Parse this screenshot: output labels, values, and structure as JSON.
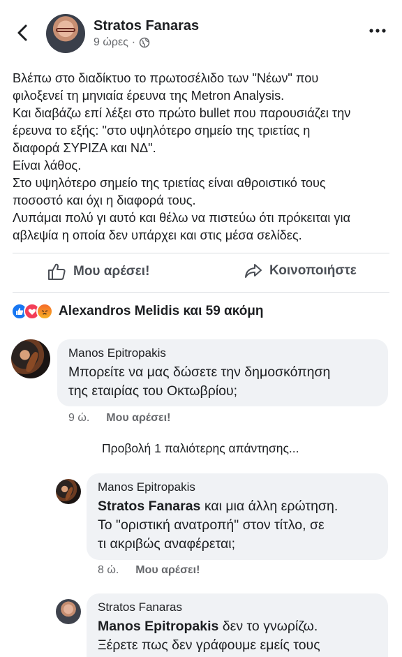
{
  "header": {
    "author": "Stratos Fanaras",
    "time": "9 ώρες",
    "dot": "·"
  },
  "post": {
    "lines": [
      "Βλέπω στο διαδίκτυο το πρωτοσέλιδο των \"Νέων\" που",
      "φιλοξενεί τη μηνιαία έρευνα της Metron Analysis.",
      "Και διαβάζω επί λέξει στο πρώτο bullet που παρουσιάζει την",
      "έρευνα το εξής: \"στο υψηλότερο σημείο της τριετίας η",
      "διαφορά ΣΥΡΙΖΑ και ΝΔ\".",
      "Είναι λάθος.",
      "Στο υψηλότερο σημείο της τριετίας είναι αθροιστικό τους",
      "ποσοστό και όχι η διαφορά τους.",
      "Λυπάμαι πολύ γι αυτό και θέλω να πιστεύω ότι πρόκειται για",
      "αβλεψία η οποία δεν υπάρχει και στις μέσα σελίδες."
    ]
  },
  "actions": {
    "like": "Μου αρέσει!",
    "share": "Κοινοποιήστε"
  },
  "reactions": {
    "text": "Alexandros Melidis και 59 ακόμη"
  },
  "comments": [
    {
      "name": "Manos Epitropakis",
      "lines": [
        "Μπορείτε να μας δώσετε την δημοσκόπηση",
        "της εταιρίας του Οκτωβρίου;"
      ],
      "time": "9 ώ.",
      "like": "Μου αρέσει!"
    }
  ],
  "view_more": "Προβολή 1 παλιότερης απάντησης...",
  "replies": [
    {
      "name": "Manos Epitropakis",
      "mention": "Stratos Fanaras",
      "line1_rest": " και μια άλλη ερώτηση.",
      "lines": [
        "Το \"οριστική ανατροπή\" στον τίτλο, σε",
        "τι ακριβώς αναφέρεται;"
      ],
      "time": "8 ώ.",
      "like": "Μου αρέσει!"
    },
    {
      "name": "Stratos Fanaras",
      "mention": "Manos Epitropakis",
      "line1_rest": " δεν το γνωρίζω.",
      "lines": [
        "Ξέρετε πως δεν γράφουμε εμείς τους"
      ]
    }
  ],
  "icons": {
    "back": "chevron-left-icon",
    "more": "more-horizontal-icon",
    "globe": "globe-icon",
    "like": "thumbs-up-icon",
    "share": "share-arrow-icon"
  },
  "colors": {
    "like_blue": "#1877f2",
    "love_red": "#f33e58",
    "bubble_bg": "#f0f2f5",
    "secondary_text": "#65676b"
  }
}
